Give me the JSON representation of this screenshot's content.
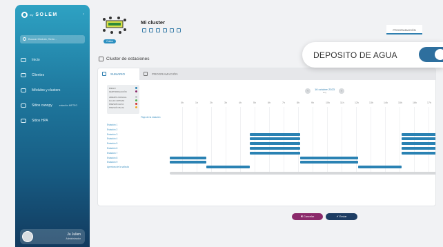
{
  "sidebar": {
    "brand": "SOLEM",
    "brand_prefix": "my",
    "search_placeholder": "Buscar Módulo, Serie...",
    "items": [
      {
        "label": "Inicio",
        "sub": ""
      },
      {
        "label": "Clientes",
        "sub": ""
      },
      {
        "label": "Módulos y clusters",
        "sub": ""
      },
      {
        "label": "Sitios canopy",
        "sub": "estación METEO"
      },
      {
        "label": "Sitios HPA",
        "sub": ""
      }
    ],
    "user": {
      "name": "Ju Julien",
      "role": "Administrador"
    }
  },
  "header": {
    "title": "Mi cluster",
    "status": "Online",
    "tab_programacion": "PROGRAMACIÓN"
  },
  "section_title": "Cluster de estaciones",
  "panel": {
    "tabs": [
      {
        "label": "SUMARIO"
      },
      {
        "label": "PROGRAMACIÓN"
      }
    ],
    "legend": [
      {
        "label": "RIEGO",
        "color": "#2a82b3"
      },
      {
        "label": "FERTIRRIGACIÓN",
        "color": "#8b2a6b"
      },
      {
        "label": "ABIERTA MANUAL",
        "color": "#bfc3c7"
      },
      {
        "label": "FLUJO OPTIMO",
        "color": "#4caf50"
      },
      {
        "label": "PRESIÓN ALTA",
        "color": "#d32f2f"
      },
      {
        "label": "PRESIÓN BAJA",
        "color": "#f5a623"
      }
    ],
    "date": "16 octubre 2023",
    "date_sub": "Hoy",
    "flow_label": "Flujo de la estación",
    "hours": [
      "0h",
      "1h",
      "2h",
      "3h",
      "4h",
      "5h",
      "6h",
      "7h",
      "8h",
      "9h",
      "10h",
      "11h",
      "12h",
      "13h",
      "14h",
      "15h",
      "16h",
      "17h"
    ],
    "stations": [
      "Estación 1",
      "Estación 2",
      "Estación 3",
      "Estación 4",
      "Estación 5",
      "Estación 6",
      "Estación 7",
      "Estación 8",
      "Estación 9",
      "Apertura de la válvula"
    ]
  },
  "buttons": {
    "cancel": "✖ Cancelar",
    "send": "✔ Enviar"
  },
  "toast": {
    "label": "DEPOSITO DE AGUA",
    "toggle_on": true
  }
}
